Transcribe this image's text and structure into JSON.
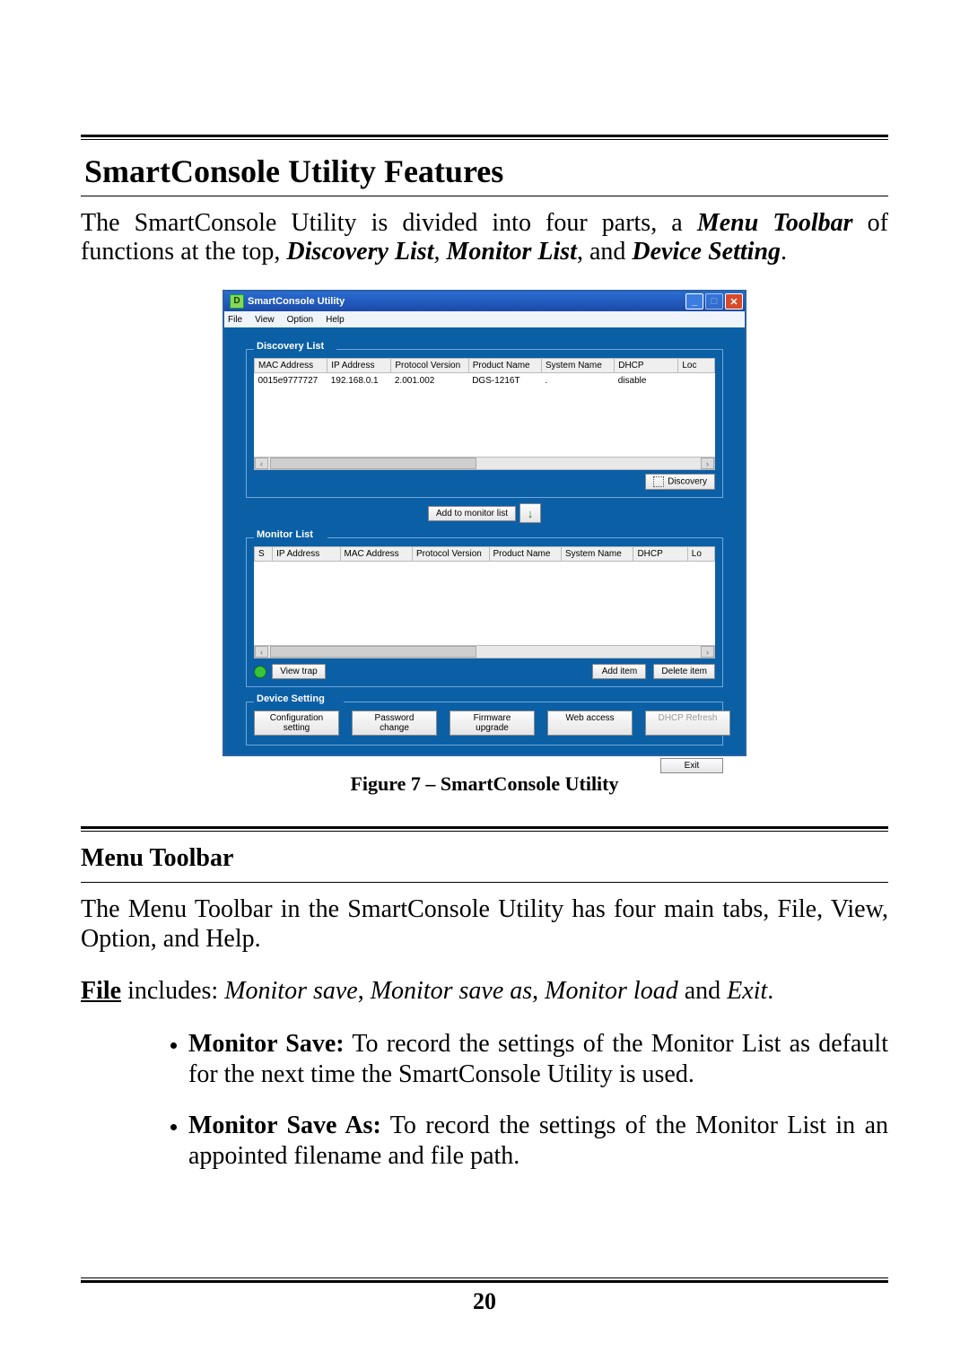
{
  "section_title": "SmartConsole Utility Features",
  "intro": {
    "t1": "The SmartConsole Utility is divided into four parts, a ",
    "b1": "Menu Toolbar",
    "t2": " of functions at the top, ",
    "i1": "Discovery List",
    "c1": ", ",
    "i2": "Monitor List",
    "t3": ", and ",
    "i3": "Device Setting",
    "t4": "."
  },
  "app": {
    "title_icon": "D",
    "title": "SmartConsole Utility",
    "menu": [
      "File",
      "View",
      "Option",
      "Help"
    ],
    "discovery": {
      "legend": "Discovery List",
      "headers": [
        "MAC Address",
        "IP Address",
        "Protocol Version",
        "Product Name",
        "System Name",
        "DHCP",
        "Loc"
      ],
      "rows": [
        {
          "mac": "0015e9777727",
          "ip": "192.168.0.1",
          "pv": "2.001.002",
          "pn": "DGS-1216T",
          "sn": ".",
          "dhcp": "disable",
          "loc": ""
        }
      ],
      "discovery_btn": "Discovery"
    },
    "add_to_monitor": "Add to monitor list",
    "monitor": {
      "legend": "Monitor List",
      "headers": [
        "S",
        "IP Address",
        "MAC Address",
        "Protocol Version",
        "Product Name",
        "System Name",
        "DHCP",
        "Lo"
      ],
      "view_trap": "View trap",
      "add_item": "Add item",
      "delete_item": "Delete item"
    },
    "device": {
      "legend": "Device Setting",
      "cfg": "Configuration setting",
      "pwd": "Password change",
      "fw": "Firmware upgrade",
      "web": "Web access",
      "dhcp": "DHCP Refresh"
    },
    "exit": "Exit"
  },
  "caption": "Figure 7 – SmartConsole Utility",
  "subsection": "Menu Toolbar",
  "sub_body": "The Menu Toolbar in the SmartConsole Utility has four main tabs, File, View, Option, and Help.",
  "file_line": {
    "u": "File",
    "t1": " includes: ",
    "i1": "Monitor save",
    "c1": ", ",
    "i2": "Monitor save as",
    "c2": ", ",
    "i3": "Monitor load",
    "t2": " and ",
    "i4": "Exit",
    "t3": "."
  },
  "bullets": {
    "b1_bold": "Monitor Save:",
    "b1_rest": " To record the settings of the Monitor List as default for the next time the SmartConsole Utility is used.",
    "b2_bold": "Monitor Save As:",
    "b2_rest": " To record the settings of the Monitor List in an appointed filename and file path."
  },
  "page_number": "20"
}
